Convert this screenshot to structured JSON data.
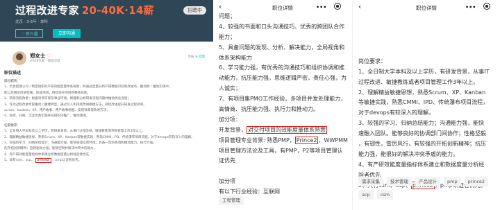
{
  "left": {
    "title": "过程改进专家",
    "salary": "20-40K·14薪",
    "status": "招聘中",
    "meta": "北京 · 3-5年 · 本科",
    "fav_label": "♡ 感兴趣",
    "chat_label": "立即沟通",
    "recruiter": {
      "name": "郑女士",
      "sub": "HRBP专家 · 刚刚活跃",
      "right": "举报",
      "right_extra": "✉ 反馈"
    },
    "section_title": "职位描述",
    "lines": [
      {
        "t": "岗位职责：",
        "h": true
      },
      {
        "t": "1、负责搭建公司 / 制定组织的产研效能度量体系规划，并通过度量分析产研数据识别到改进点，推动到 / 推动实践中。"
      },
      {
        "t": "   能以及相应改进措施，形成项目，持续提升项目的整体效能。"
      },
      {
        "t": "2、研发流程改善：根据项目实际及事业环境，梳理和分析研发流程问题并推动优化流程；"
      },
      {
        "t": "3、作为过程改进专家推动 / 敏捷转型，通过引入和持续改进敏捷方法，持续改进提升研发过程效率。"
      },
      {
        "t": "   scrum、kanban、XP、用户故事、用户故事地图、反馈效率等改进方法；"
      },
      {
        "t": "4、总结、归纳、沉淀优秀实践并在组织内推广，推动落地。"
      },
      {
        "gap": true
      },
      {
        "t": "任职要求：",
        "h": true
      },
      {
        "t": "1、全日制大学本科及以上学历，有研发背景，从事IT过程改进、敏捷教练或项目管理工作3年以上。"
      },
      {
        "t": "2、理解精益敏捷思想，熟悉Scrum、XP、Kanban等敏捷实践，熟悉CMMI、PD、传统瀑布项目流程，对于devops有较深入的理解。"
      },
      {
        "t": "3、较强的学习、归纳总结能力；沟通能力强，能快速适应新环境；具备一定的协调和推动能力，执行力强。"
      },
      {
        "t": "   的开拓创新精神；自我驱动力强，能够控制并解决冲突中的能力。"
      },
      {
        "t": "4、有产研效能度量指标体系建立和数据度量分析经验者优先"
      },
      {
        "t": "5、具有csm、acp、",
        "mark": "prince2",
        "after": "，pmp认证者优先。"
      }
    ]
  },
  "mid": {
    "nav_title": "职位详情",
    "rows": [
      {
        "t": "问题；"
      },
      {
        "t": "4、较强的书面和口头沟通技巧、优秀的跨团队合作"
      },
      {
        "t": "能力；"
      },
      {
        "t": "5、具备问题的发现、分析、解决能力，全局视角和"
      },
      {
        "t": "体系架构能力"
      },
      {
        "t": "6、学习能力强，有优秀的沟通技巧和组织协调和推"
      },
      {
        "t": "动能力，抗压能力强，思维逻辑严密，责任心强，为"
      },
      {
        "t": "人诚实；"
      },
      {
        "t": "7、有项目集PMO工作经验，多项目并发处理能力，"
      },
      {
        "t": "高情商、抗压能力强、执行力和推动力。"
      },
      {
        "t": "加分项："
      },
      {
        "before": "开发背景，",
        "mark": "对交付项目的效能度量体系熟悉"
      },
      {
        "before": "项目管理专业背景: 熟悉PMP，",
        "mark": "Prince2",
        "after": "，WWPMM"
      },
      {
        "t": "项目管理方法论及工具，有PMP，P2等项目管理认"
      },
      {
        "t": "证优先"
      },
      {
        "blank": true
      },
      {
        "t": "加分项"
      },
      {
        "t": "有以下行业经验：互联网"
      }
    ],
    "tags": [
      "工程管理"
    ]
  },
  "right": {
    "nav_title": "职位详情",
    "rows": [
      {
        "blank": true
      },
      {
        "t": "岗位要求："
      },
      {
        "t": "1、全日制大学本科及以上学历，有研发背景，从事IT"
      },
      {
        "t": "过程改进、敏捷教练或者项目管理工作3年以上。"
      },
      {
        "t": "2、理解精益敏捷思想，熟悉Scrum、XP、Kanban"
      },
      {
        "t": "等敏捷实践，熟悉CMMI、IPD、传统瀑布项目流程，"
      },
      {
        "t": "对于devops有较深入的理解。"
      },
      {
        "t": "3、较强的学习、归纳总结能力；沟通能力强，能快"
      },
      {
        "t": "速融入团队。能够良好的协调部门间协作；性格坚毅"
      },
      {
        "t": "，有韧性，雷厉风行，有较强的开拓创新精神；抗压"
      },
      {
        "t": "能力强，能很好的解决冲突矛盾的能力。"
      },
      {
        "t": "4、有产研效能度量指标体系建立和数据度量分析经"
      },
      {
        "t": "验者优先"
      },
      {
        "before": "5、具有csm、acp、",
        "mark": "prince2",
        "after": "，pmp认证者优先。"
      }
    ],
    "tags": [
      "需求采集",
      "技术管理",
      "产品设计",
      "pmp",
      "prince2",
      "acp",
      "csm"
    ]
  }
}
